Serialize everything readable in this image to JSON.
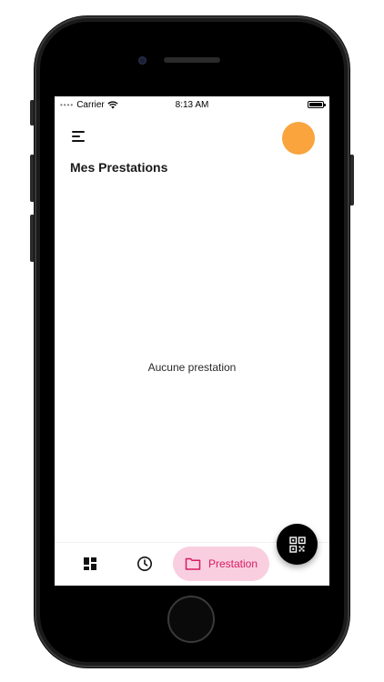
{
  "status_bar": {
    "carrier": "Carrier",
    "time": "8:13 AM",
    "signal_icon": "signal-dots-icon",
    "wifi_icon": "wifi-icon",
    "battery_icon": "battery-icon"
  },
  "header": {
    "menu_icon": "menu-icon",
    "avatar_color": "#F9A43D",
    "title": "Mes Prestations"
  },
  "main": {
    "empty_message": "Aucune prestation"
  },
  "fab": {
    "icon": "qr-code-icon"
  },
  "bottom_nav": {
    "items": [
      {
        "icon": "dashboard-icon",
        "label": "",
        "active": false
      },
      {
        "icon": "history-clock-icon",
        "label": "",
        "active": false
      },
      {
        "icon": "folder-icon",
        "label": "Prestation",
        "active": true
      }
    ]
  },
  "colors": {
    "accent": "#D81B60",
    "accent_bg": "#F9CFE0",
    "avatar": "#F9A43D"
  }
}
